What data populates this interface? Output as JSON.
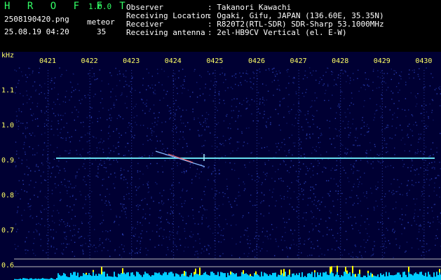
{
  "header": {
    "app_name": "H R O F F T",
    "version": "1.0.0",
    "filename": "2508190420.png",
    "datetime": "25.08.19 04:20",
    "meteor_label": "meteor",
    "meteor_count": "35",
    "info_labels": [
      "Observer",
      "Receiving Location",
      "Receiver",
      "Receiving antenna"
    ],
    "info_values": [
      ": Takanori Kawachi",
      ": Ogaki, Gifu, JAPAN (136.60E, 35.35N)",
      ": R820T2(RTL-SDR) SDR-Sharp 53.1000MHz",
      ": 2el-HB9CV Vertical (el. E-W)"
    ]
  },
  "spectrogram": {
    "y_unit": "kHz",
    "time_ticks": [
      "0421",
      "0422",
      "0423",
      "0424",
      "0425",
      "0426",
      "0427",
      "0428",
      "0429",
      "0430"
    ],
    "freq_ticks": [
      "1.1",
      "1.0",
      "0.9",
      "0.8",
      "0.7",
      "0.6"
    ],
    "colors": {
      "background": "#000033",
      "noise": "#1a2a8c",
      "carrier": "#66ddee",
      "axis_text": "#ffff66",
      "baseline": "#00ccff",
      "peak": "#ffff00"
    }
  }
}
